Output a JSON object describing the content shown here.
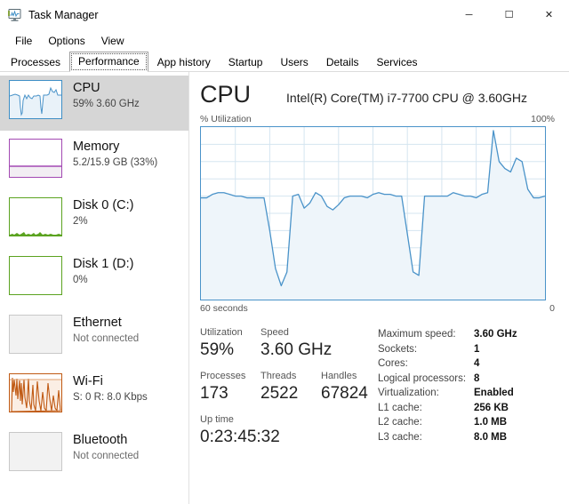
{
  "window": {
    "title": "Task Manager",
    "icon": "task-manager-icon",
    "minimize": "─",
    "maximize": "☐",
    "close": "✕"
  },
  "menu": [
    "File",
    "Options",
    "View"
  ],
  "tabs": [
    {
      "label": "Processes",
      "active": false
    },
    {
      "label": "Performance",
      "active": true
    },
    {
      "label": "App history",
      "active": false
    },
    {
      "label": "Startup",
      "active": false
    },
    {
      "label": "Users",
      "active": false
    },
    {
      "label": "Details",
      "active": false
    },
    {
      "label": "Services",
      "active": false
    }
  ],
  "sidebar": {
    "items": [
      {
        "name": "CPU",
        "sub": "59%  3.60 GHz",
        "kind": "cpu",
        "selected": true
      },
      {
        "name": "Memory",
        "sub": "5.2/15.9 GB (33%)",
        "kind": "mem",
        "selected": false
      },
      {
        "name": "Disk 0 (C:)",
        "sub": "2%",
        "kind": "disk",
        "selected": false
      },
      {
        "name": "Disk 1 (D:)",
        "sub": "0%",
        "kind": "disk",
        "selected": false
      },
      {
        "name": "Ethernet",
        "sub": "Not connected",
        "kind": "idle",
        "selected": false
      },
      {
        "name": "Wi-Fi",
        "sub": "S: 0 R: 8.0 Kbps",
        "kind": "wifi",
        "selected": false
      },
      {
        "name": "Bluetooth",
        "sub": "Not connected",
        "kind": "idle",
        "selected": false
      }
    ]
  },
  "main": {
    "title": "CPU",
    "model": "Intel(R) Core(TM) i7-7700 CPU @ 3.60GHz",
    "graph_top_left": "% Utilization",
    "graph_top_right": "100%",
    "graph_bottom_left": "60 seconds",
    "graph_bottom_right": "0",
    "stats": [
      {
        "name": "Utilization",
        "value": "59%"
      },
      {
        "name": "Speed",
        "value": "3.60 GHz"
      },
      {
        "name": "Processes",
        "value": "173"
      },
      {
        "name": "Threads",
        "value": "2522"
      },
      {
        "name": "Handles",
        "value": "67824"
      },
      {
        "name": "Up time",
        "value": "0:23:45:32"
      }
    ],
    "details": [
      {
        "key": "Maximum speed:",
        "value": "3.60 GHz"
      },
      {
        "key": "Sockets:",
        "value": "1"
      },
      {
        "key": "Cores:",
        "value": "4"
      },
      {
        "key": "Logical processors:",
        "value": "8"
      },
      {
        "key": "Virtualization:",
        "value": "Enabled"
      },
      {
        "key": "L1 cache:",
        "value": "256 KB"
      },
      {
        "key": "L2 cache:",
        "value": "1.0 MB"
      },
      {
        "key": "L3 cache:",
        "value": "8.0 MB"
      }
    ]
  },
  "colors": {
    "cpu_line": "#4a93c9",
    "cpu_fill": "#eef5fa",
    "grid": "#d5e5f0",
    "memory": "#a349b3",
    "disk": "#5ba320",
    "wifi": "#c05a14",
    "selected_row": "#d6d6d6"
  },
  "chart_data": {
    "type": "area",
    "title": "CPU % Utilization",
    "xlabel": "60 seconds",
    "ylabel": "% Utilization",
    "ylim": [
      0,
      100
    ],
    "xlim": [
      0,
      60
    ],
    "grid": true,
    "legend": "none",
    "x": [
      0,
      1,
      2,
      3,
      4,
      5,
      6,
      7,
      8,
      9,
      10,
      11,
      12,
      13,
      14,
      15,
      16,
      17,
      18,
      19,
      20,
      21,
      22,
      23,
      24,
      25,
      26,
      27,
      28,
      29,
      30,
      31,
      32,
      33,
      34,
      35,
      36,
      37,
      38,
      39,
      40,
      41,
      42,
      43,
      44,
      45,
      46,
      47,
      48,
      49,
      50,
      51,
      52,
      53,
      54,
      55,
      56,
      57,
      58,
      59,
      60
    ],
    "values": [
      59,
      59,
      61,
      62,
      62,
      61,
      60,
      60,
      59,
      59,
      59,
      59,
      40,
      18,
      8,
      16,
      60,
      61,
      53,
      56,
      62,
      60,
      54,
      52,
      55,
      59,
      60,
      60,
      60,
      59,
      61,
      62,
      61,
      61,
      60,
      60,
      38,
      16,
      14,
      60,
      60,
      60,
      60,
      60,
      62,
      61,
      60,
      60,
      59,
      61,
      62,
      98,
      80,
      76,
      74,
      82,
      80,
      64,
      59,
      59,
      60
    ],
    "series": [
      {
        "name": "CPU utilization",
        "values": [
          59,
          59,
          61,
          62,
          62,
          61,
          60,
          60,
          59,
          59,
          59,
          59,
          40,
          18,
          8,
          16,
          60,
          61,
          53,
          56,
          62,
          60,
          54,
          52,
          55,
          59,
          60,
          60,
          60,
          59,
          61,
          62,
          61,
          61,
          60,
          60,
          38,
          16,
          14,
          60,
          60,
          60,
          60,
          60,
          62,
          61,
          60,
          60,
          59,
          61,
          62,
          98,
          80,
          76,
          74,
          82,
          80,
          64,
          59,
          59,
          60
        ]
      }
    ]
  }
}
